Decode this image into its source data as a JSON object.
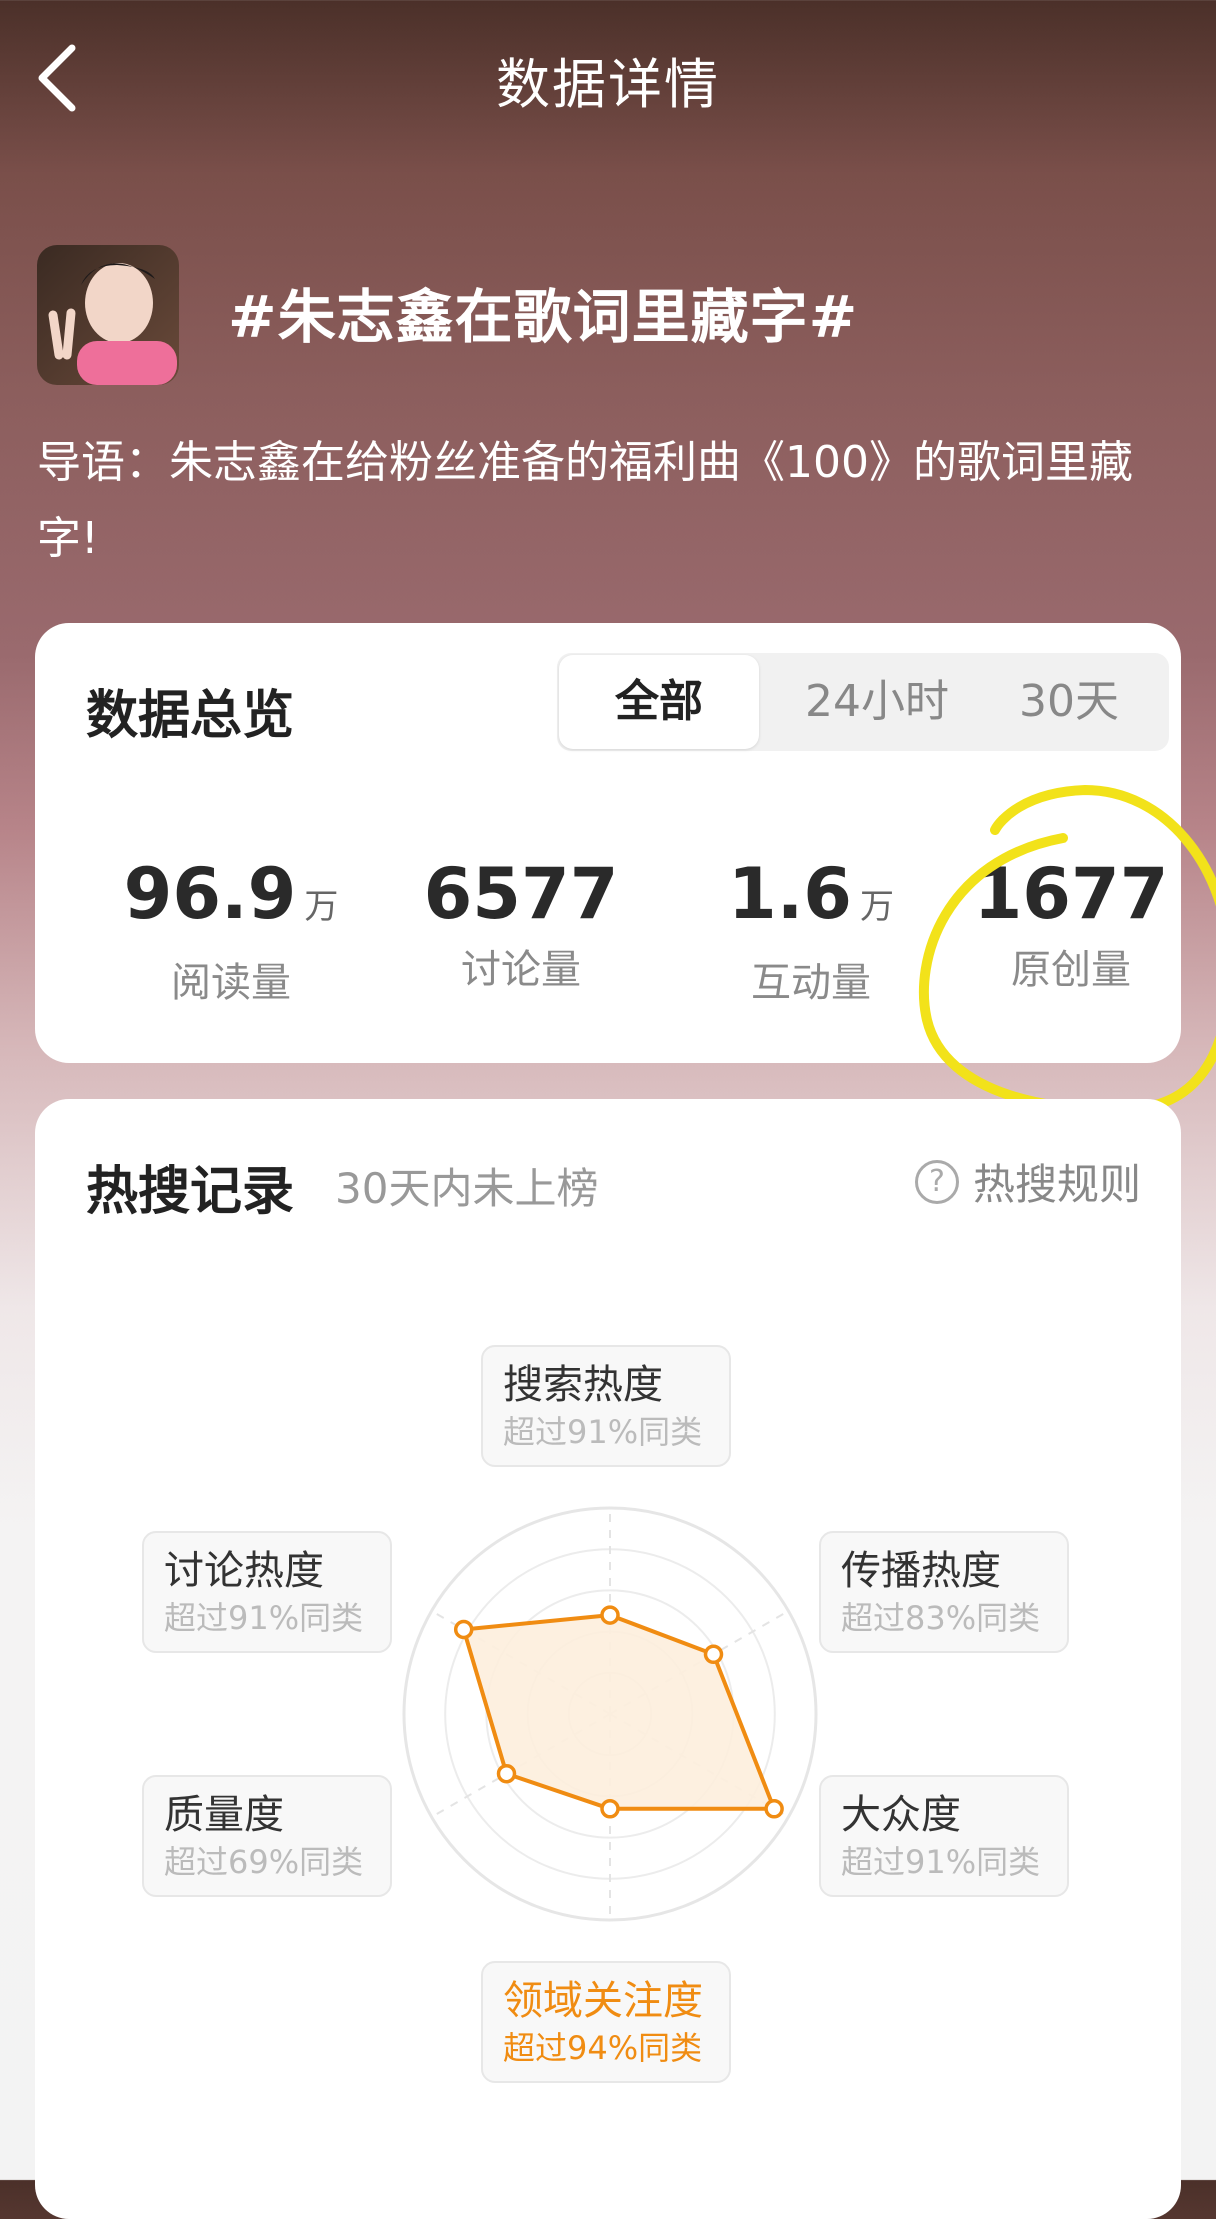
{
  "header": {
    "title": "数据详情"
  },
  "topic": {
    "title": "#朱志鑫在歌词里藏字#",
    "intro": "导语：朱志鑫在给粉丝准备的福利曲《100》的歌词里藏字!"
  },
  "overview": {
    "title": "数据总览",
    "tabs": [
      "全部",
      "24小时",
      "30天"
    ],
    "active_tab": "全部",
    "stats": [
      {
        "value": "96.9",
        "unit": "万",
        "label": "阅读量"
      },
      {
        "value": "6577",
        "unit": "",
        "label": "讨论量"
      },
      {
        "value": "1.6",
        "unit": "万",
        "label": "互动量"
      },
      {
        "value": "1677",
        "unit": "",
        "label": "原创量"
      }
    ]
  },
  "hot_search": {
    "title": "热搜记录",
    "subtitle": "30天内未上榜",
    "rules_label": "热搜规则",
    "metrics": [
      {
        "name": "搜索热度",
        "desc": "超过91%同类",
        "percentile": 91
      },
      {
        "name": "传播热度",
        "desc": "超过83%同类",
        "percentile": 83
      },
      {
        "name": "大众度",
        "desc": "超过91%同类",
        "percentile": 91
      },
      {
        "name": "领域关注度",
        "desc": "超过94%同类",
        "percentile": 94,
        "highlight": true
      },
      {
        "name": "质量度",
        "desc": "超过69%同类",
        "percentile": 69
      },
      {
        "name": "讨论热度",
        "desc": "超过91%同类",
        "percentile": 91
      }
    ]
  },
  "colors": {
    "accent": "#f08c12",
    "radar_fill": "#fdeedd",
    "annotation": "#f2e21a"
  },
  "chart_data": {
    "type": "radar",
    "categories": [
      "搜索热度",
      "传播热度",
      "大众度",
      "领域关注度",
      "质量度",
      "讨论热度"
    ],
    "series": [
      {
        "values": [
          0.48,
          0.58,
          0.92,
          0.46,
          0.58,
          0.82
        ]
      }
    ],
    "ylim": [
      0,
      1
    ],
    "rings": 4
  }
}
